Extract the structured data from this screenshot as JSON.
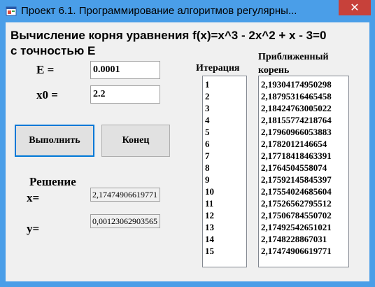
{
  "window": {
    "title": "Проект 6.1. Программирование  алгоритмов регулярны...",
    "close_glyph": "✕"
  },
  "form": {
    "heading_line1": "Вычисление корня уравнения  f(x)=x^3 - 2x^2 + x - 3=0",
    "heading_line2": "с точностью Е",
    "e_label": "E =",
    "e_value": "0.0001",
    "x0_label": "x0 =",
    "x0_value": "2.2",
    "run_button": "Выполнить",
    "end_button": "Конец",
    "solution_label": "Решение",
    "x_label": "x=",
    "x_value": "2,17474906619771",
    "y_label": "y=",
    "y_value": "0,00123062903565"
  },
  "iteration_list": {
    "header": "Итерация",
    "items": [
      "1",
      "2",
      "3",
      "4",
      "5",
      "6",
      "7",
      "8",
      "9",
      "10",
      "11",
      "12",
      "13",
      "14",
      "15"
    ]
  },
  "root_list": {
    "header_line1": "Приближенный",
    "header_line2": "корень",
    "items": [
      "2,19304174950298",
      "2,18795316465458",
      "2,18424763005022",
      "2,18155774218764",
      "2,17960966053883",
      "2,1782012146654",
      "2,17718418463391",
      "2,1764504558074",
      "2,17592145845397",
      "2,17554024685604",
      "2,17526562795512",
      "2,17506784550702",
      "2,17492542651021",
      "2,1748228867031",
      "2,17474906619771"
    ]
  }
}
